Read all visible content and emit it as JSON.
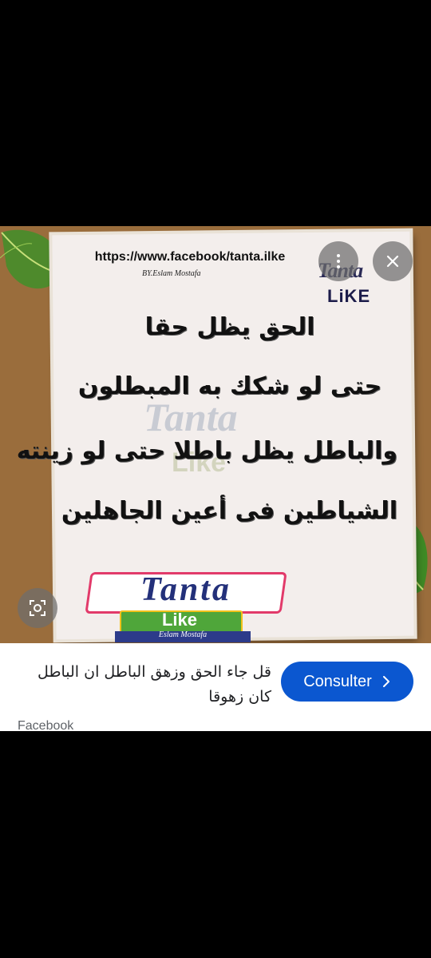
{
  "image": {
    "url_text": "https://www.facebook/tanta.ilke",
    "byline": "BY.Eslam Mostafa",
    "logo_small": {
      "tanta": "Tanta",
      "like": "LiKE"
    },
    "watermark": {
      "tanta": "Tanta",
      "like": "Like"
    },
    "verses": [
      "الحق يظل حقا",
      "حتى لو شكك به المبطلون",
      "والباطل يظل باطلا حتى لو زينته",
      "الشياطين فى أعين الجاهلين"
    ],
    "logo_big": {
      "tanta": "Tanta",
      "like": "Like",
      "author": "Eslam Mostafa"
    }
  },
  "overlay_buttons": {
    "more_icon": "more-vertical-icon",
    "close_icon": "close-icon",
    "lens_icon": "lens-search-icon"
  },
  "result": {
    "title": "قل جاء الحق وزهق الباطل ان الباطل كان زهوقا",
    "source": "Facebook",
    "button_label": "Consulter"
  },
  "colors": {
    "button_blue": "#0b57d0",
    "board_brown": "#9a6d3c",
    "paper": "#f3eeec"
  }
}
